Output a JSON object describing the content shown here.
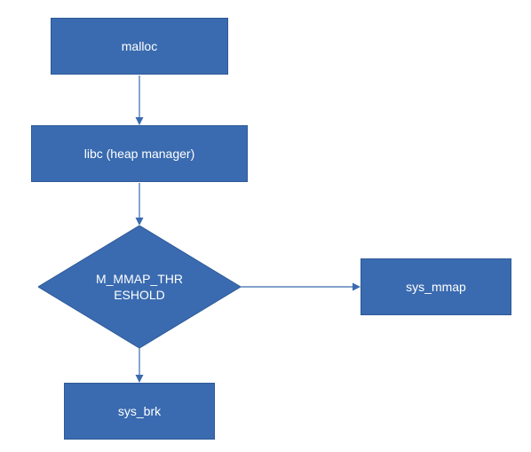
{
  "chart_data": {
    "type": "flowchart",
    "nodes": [
      {
        "id": "malloc",
        "shape": "rect",
        "label": "malloc"
      },
      {
        "id": "libc",
        "shape": "rect",
        "label": "libc (heap manager)"
      },
      {
        "id": "threshold",
        "shape": "diamond",
        "label": "M_MMAP_THRESHOLD"
      },
      {
        "id": "sys_brk",
        "shape": "rect",
        "label": "sys_brk"
      },
      {
        "id": "sys_mmap",
        "shape": "rect",
        "label": "sys_mmap"
      }
    ],
    "edges": [
      {
        "from": "malloc",
        "to": "libc"
      },
      {
        "from": "libc",
        "to": "threshold"
      },
      {
        "from": "threshold",
        "to": "sys_brk"
      },
      {
        "from": "threshold",
        "to": "sys_mmap"
      }
    ],
    "palette": {
      "node_fill": "#3a6bb0",
      "node_stroke": "#2f5a98",
      "text": "#ffffff",
      "arrow": "#3a6bb0"
    }
  },
  "nodes": {
    "malloc": {
      "label": "malloc"
    },
    "libc": {
      "label": "libc (heap manager)"
    },
    "threshold": {
      "label_line1": "M_MMAP_THR",
      "label_line2": "ESHOLD"
    },
    "sys_brk": {
      "label": "sys_brk"
    },
    "sys_mmap": {
      "label": "sys_mmap"
    }
  }
}
